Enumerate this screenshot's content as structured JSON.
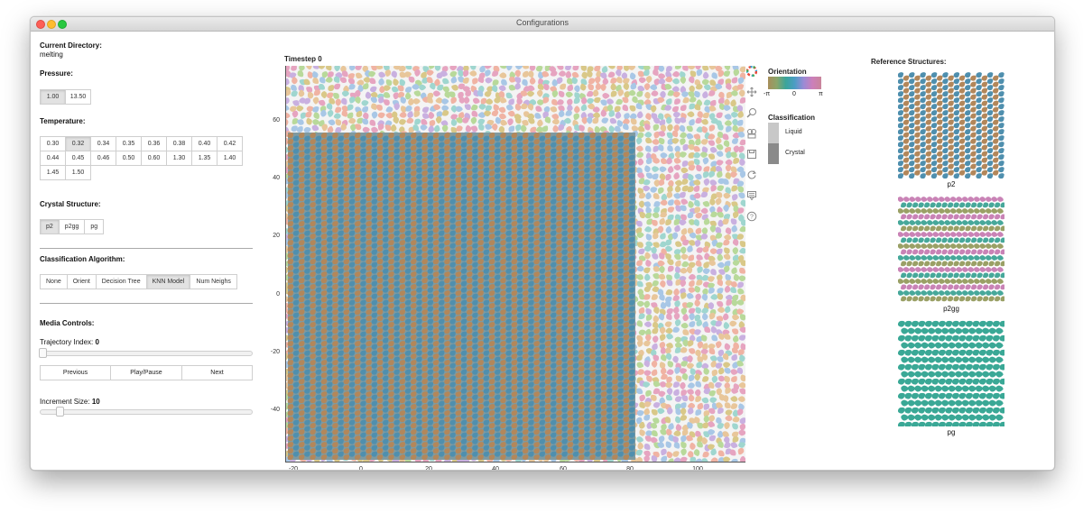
{
  "window": {
    "title": "Configurations"
  },
  "controls": {
    "directory_label": "Current Directory:",
    "directory_value": "melting",
    "pressure_label": "Pressure:",
    "pressure_options": [
      "1.00",
      "13.50"
    ],
    "pressure_selected": "1.00",
    "temperature_label": "Temperature:",
    "temperature_options": [
      "0.30",
      "0.32",
      "0.34",
      "0.35",
      "0.36",
      "0.38",
      "0.40",
      "0.42",
      "0.44",
      "0.45",
      "0.46",
      "0.50",
      "0.60",
      "1.30",
      "1.35",
      "1.40",
      "1.45",
      "1.50"
    ],
    "temperature_selected": "0.32",
    "structure_label": "Crystal Structure:",
    "structure_options": [
      "p2",
      "p2gg",
      "pg"
    ],
    "structure_selected": "p2",
    "algorithm_label": "Classification Algorithm:",
    "algorithm_options": [
      "None",
      "Orient",
      "Decision Tree",
      "KNN Model",
      "Num Neighs"
    ],
    "algorithm_selected": "KNN Model"
  },
  "media": {
    "title": "Media Controls:",
    "trajectory_label": "Trajectory Index:",
    "trajectory_value": "0",
    "previous": "Previous",
    "playpause": "Play/Pause",
    "next": "Next",
    "increment_label": "Increment Size:",
    "increment_value": "10"
  },
  "plot": {
    "title": "Timestep 0",
    "x_ticks": [
      "-20",
      "0",
      "20",
      "40",
      "60",
      "80",
      "100"
    ],
    "y_ticks": [
      "60",
      "40",
      "20",
      "0",
      "-20",
      "-40"
    ]
  },
  "legend": {
    "orientation_title": "Orientation",
    "orientation_ticks": [
      "-π",
      "0",
      "π"
    ],
    "classification_title": "Classification",
    "classes": [
      {
        "label": "Liquid",
        "color": "#c8c8c8"
      },
      {
        "label": "Crystal",
        "color": "#8a8a8a"
      }
    ]
  },
  "toolbar": {
    "tools": [
      "bokeh-logo-icon",
      "pan-icon",
      "zoom-icon",
      "box-zoom-icon",
      "save-icon",
      "reset-icon",
      "hover-icon",
      "help-icon"
    ]
  },
  "references": {
    "title": "Reference Structures:",
    "items": [
      {
        "caption": "p2",
        "colors": [
          "#4f8fae",
          "#b3875a"
        ]
      },
      {
        "caption": "p2gg",
        "colors": [
          "#c983b6",
          "#47a89a",
          "#9aa066"
        ]
      },
      {
        "caption": "pg",
        "colors": [
          "#3aa896"
        ]
      }
    ]
  },
  "colors": {
    "crystal_blue": "#4f8fae",
    "crystal_brown": "#b3875a",
    "liquid_palette": [
      "#e6a4c0",
      "#a8c7e6",
      "#b8d99a",
      "#e8c69a",
      "#c9b0e0",
      "#9fd6cf",
      "#f0b3a3",
      "#d9c888"
    ]
  }
}
